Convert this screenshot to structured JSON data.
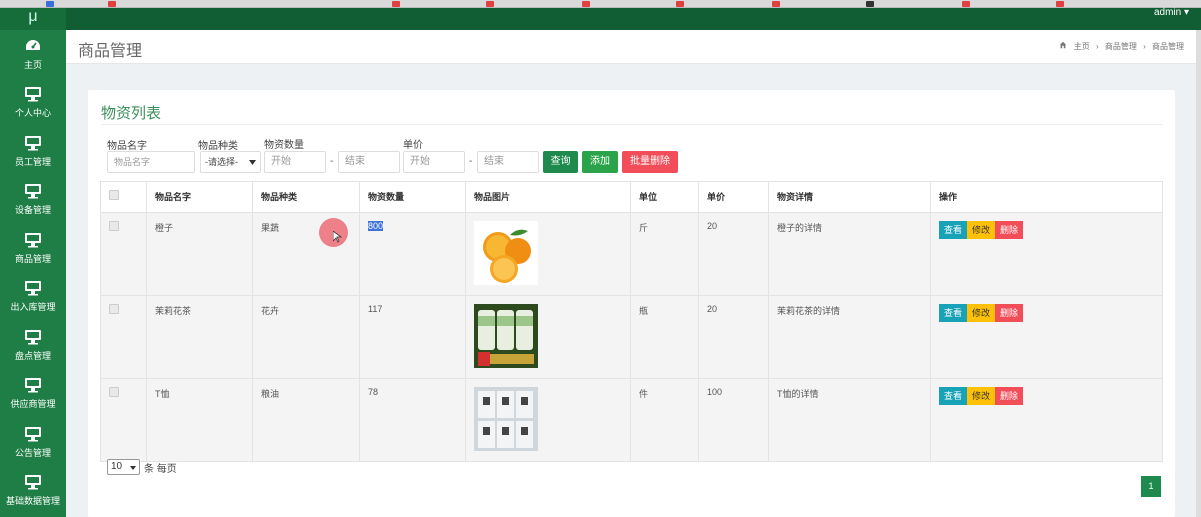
{
  "app": {
    "logo": "μ",
    "user": "admin ▾"
  },
  "sidebar": {
    "items": [
      {
        "label": "主页",
        "icon": "dashboard-icon"
      },
      {
        "label": "个人中心",
        "icon": "monitor-icon"
      },
      {
        "label": "员工管理",
        "icon": "monitor-icon"
      },
      {
        "label": "设备管理",
        "icon": "monitor-icon"
      },
      {
        "label": "商品管理",
        "icon": "monitor-icon"
      },
      {
        "label": "出入库管理",
        "icon": "monitor-icon"
      },
      {
        "label": "盘点管理",
        "icon": "monitor-icon"
      },
      {
        "label": "供应商管理",
        "icon": "monitor-icon"
      },
      {
        "label": "公告管理",
        "icon": "monitor-icon"
      },
      {
        "label": "基础数据管理",
        "icon": "monitor-icon"
      }
    ]
  },
  "header": {
    "title": "商品管理",
    "breadcrumb": [
      "主页",
      "›",
      "商品管理",
      "›",
      "商品管理"
    ]
  },
  "card": {
    "title": "物资列表"
  },
  "filters": {
    "name_label": "物品名字",
    "name_placeholder": "物品名字",
    "type_label": "物品种类",
    "type_value": "-请选择-",
    "qty_label": "物资数量",
    "qty_start": "开始",
    "qty_end": "结束",
    "price_label": "单价",
    "price_start": "开始",
    "price_end": "结束",
    "dash": "-",
    "query": "查询",
    "add": "添加",
    "batch_delete": "批量删除"
  },
  "table": {
    "headers": [
      "物品名字",
      "物品种类",
      "物资数量",
      "物品图片",
      "单位",
      "单价",
      "物资详情",
      "操作"
    ],
    "rows": [
      {
        "name": "橙子",
        "type": "果蔬",
        "qty": "800",
        "unit": "斤",
        "price": "20",
        "detail": "橙子的详情",
        "image": "orange-image"
      },
      {
        "name": "茉莉花茶",
        "type": "花卉",
        "qty": "117",
        "unit": "瓶",
        "price": "20",
        "detail": "茉莉花茶的详情",
        "image": "tea-image"
      },
      {
        "name": "T恤",
        "type": "粮油",
        "qty": "78",
        "unit": "件",
        "price": "100",
        "detail": "T恤的详情",
        "image": "tshirt-image"
      }
    ],
    "actions": {
      "view": "查看",
      "edit": "修改",
      "delete": "删除"
    }
  },
  "pager": {
    "per_page": "10",
    "per_page_suffix": "条 每页",
    "page": "1"
  },
  "colors": {
    "sidebar": "#1e7e45",
    "topbar": "#115e35",
    "query_btn": "#1e8a4d",
    "add_btn": "#2aa34a",
    "delete_btn": "#f14e5a",
    "view_btn": "#17a2b8",
    "edit_btn": "#ffc107",
    "del_btn": "#f14e5a"
  }
}
